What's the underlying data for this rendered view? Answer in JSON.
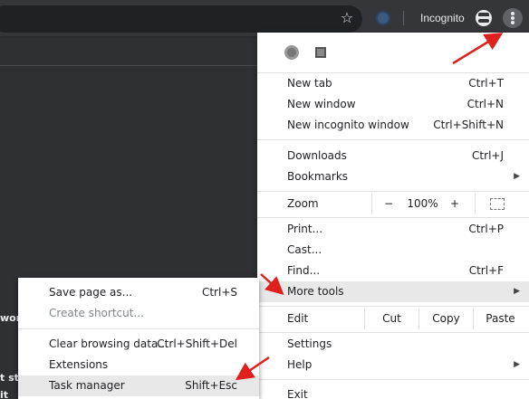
{
  "toolbar": {
    "incognito_label": "Incognito",
    "star_icon": "star-icon",
    "menu_icon": "three-dot-menu-icon"
  },
  "page": {
    "fragments": [
      "won",
      "t sti",
      "it"
    ]
  },
  "menu": {
    "new_tab": {
      "label": "New tab",
      "shortcut": "Ctrl+T"
    },
    "new_window": {
      "label": "New window",
      "shortcut": "Ctrl+N"
    },
    "new_incognito": {
      "label": "New incognito window",
      "shortcut": "Ctrl+Shift+N"
    },
    "downloads": {
      "label": "Downloads",
      "shortcut": "Ctrl+J"
    },
    "bookmarks": {
      "label": "Bookmarks"
    },
    "zoom": {
      "label": "Zoom",
      "minus": "−",
      "value": "100%",
      "plus": "+"
    },
    "print": {
      "label": "Print...",
      "shortcut": "Ctrl+P"
    },
    "cast": {
      "label": "Cast..."
    },
    "find": {
      "label": "Find...",
      "shortcut": "Ctrl+F"
    },
    "more_tools": {
      "label": "More tools"
    },
    "edit": {
      "label": "Edit",
      "cut": "Cut",
      "copy": "Copy",
      "paste": "Paste"
    },
    "settings": {
      "label": "Settings"
    },
    "help": {
      "label": "Help"
    },
    "exit": {
      "label": "Exit"
    }
  },
  "submenu": {
    "save_page": {
      "label": "Save page as...",
      "shortcut": "Ctrl+S"
    },
    "create_shortcut": {
      "label": "Create shortcut..."
    },
    "clear_browsing": {
      "label": "Clear browsing data...",
      "shortcut": "Ctrl+Shift+Del"
    },
    "extensions": {
      "label": "Extensions"
    },
    "task_manager": {
      "label": "Task manager",
      "shortcut": "Shift+Esc"
    }
  },
  "colors": {
    "toolbar_bg": "#35363a",
    "menu_bg": "#ffffff",
    "highlight": "#e8e8e8",
    "annotation_arrow": "#e0201c"
  }
}
